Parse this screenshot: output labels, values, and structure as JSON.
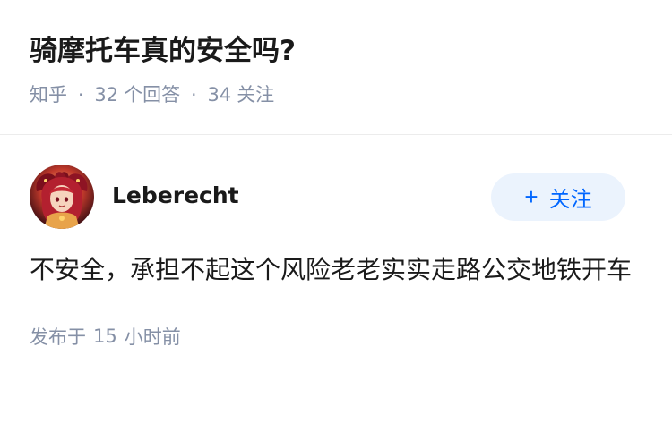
{
  "question": {
    "title": "骑摩托车真的安全吗?",
    "source": "知乎",
    "separator": "·",
    "answer_count": "32",
    "answer_label": "个回答",
    "follow_count": "34",
    "follow_label": "关注"
  },
  "answer": {
    "author_name": "Leberecht",
    "follow_button_label": "关注",
    "follow_button_icon": "plus-icon",
    "content": "不安全，承担不起这个风险老老实实走路公交地铁开车",
    "published_label": "发布于",
    "published_value": "15",
    "published_unit": "小时前"
  },
  "colors": {
    "accent": "#0066ff",
    "accent_bg": "#ebf3fd",
    "meta": "#8590a6",
    "text": "#1a1a1a"
  }
}
